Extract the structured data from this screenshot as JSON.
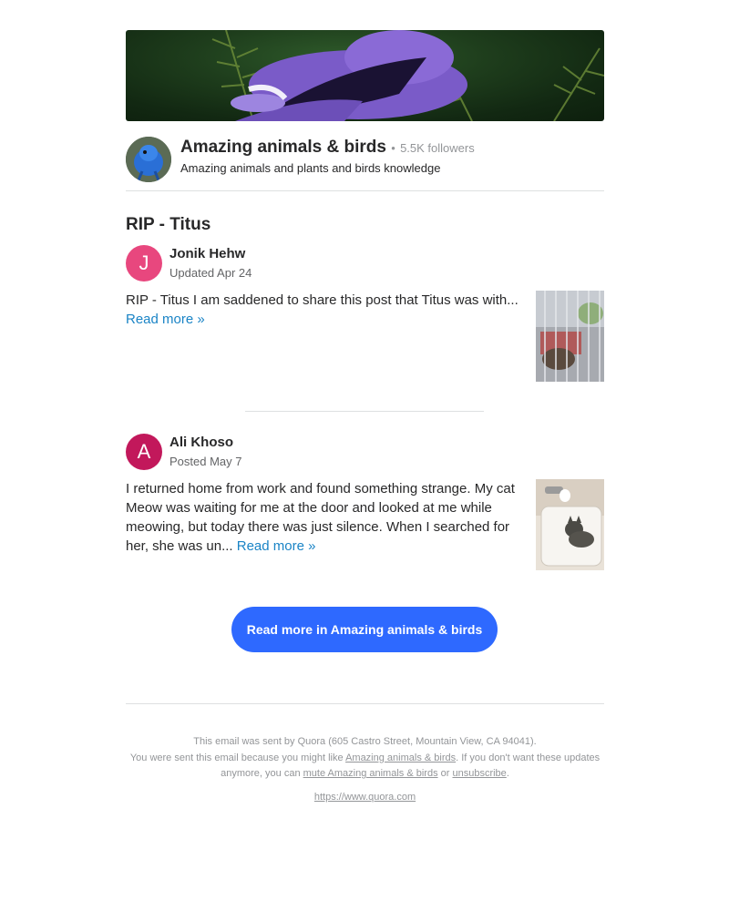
{
  "space": {
    "name": "Amazing animals & birds",
    "followers": "5.5K followers",
    "separator": "•",
    "description": "Amazing animals and plants and birds knowledge"
  },
  "post_title": "RIP - Titus",
  "posts": [
    {
      "initial": "J",
      "avatar_color": "#e8477e",
      "author": "Jonik Hehw",
      "meta": "Updated Apr 24",
      "excerpt": "RIP - Titus I am saddened to share this post that Titus was with... ",
      "read_more": "Read more »"
    },
    {
      "initial": "A",
      "avatar_color": "#c2185b",
      "author": "Ali Khoso",
      "meta": "Posted May 7",
      "excerpt": "I returned home from work and found something strange. My cat Meow was waiting for me at the door and looked at me while meowing, but today there was just silence. When I searched for her, she was un... ",
      "read_more": "Read more »"
    }
  ],
  "cta_label": "Read more in Amazing animals & birds",
  "footer": {
    "line1": "This email was sent by Quora (605 Castro Street, Mountain View, CA 94041).",
    "line2_pre": "You were sent this email because you might like ",
    "line2_link": "Amazing animals & birds",
    "line2_post": ". If you don't want these updates anymore, you can ",
    "mute_link": "mute Amazing animals & birds",
    "or_text": " or ",
    "unsubscribe_link": "unsubscribe",
    "period": ".",
    "site_link": "https://www.quora.com"
  },
  "colors": {
    "accent": "#2e69ff",
    "link": "#1a84c6",
    "text": "#282829",
    "muted": "#939598"
  }
}
